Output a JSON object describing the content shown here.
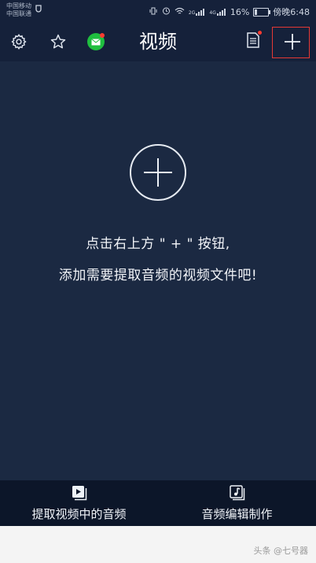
{
  "status": {
    "carrier_1": "中国移动",
    "carrier_2": "中国联通",
    "battery": "16%",
    "time": "傍晚6:48",
    "network_1": "2G",
    "network_2": "4G",
    "battery_level": 0.16
  },
  "header": {
    "title": "视频",
    "icons": [
      "gear-icon",
      "star-icon",
      "mail-icon",
      "document-icon",
      "plus-icon"
    ]
  },
  "main": {
    "hint_line_1": "点击右上方 \" + \" 按钮,",
    "hint_line_2": "添加需要提取音频的视频文件吧!"
  },
  "bottom_tabs": [
    {
      "label": "提取视频中的音频",
      "icon": "video-play-icon"
    },
    {
      "label": "音频编辑制作",
      "icon": "music-note-icon"
    }
  ],
  "watermark": "头条 @七号器",
  "colors": {
    "background": "#1b2942",
    "header": "#15213a",
    "bottom_bar": "#0c1629",
    "annotation": "#e53935"
  }
}
